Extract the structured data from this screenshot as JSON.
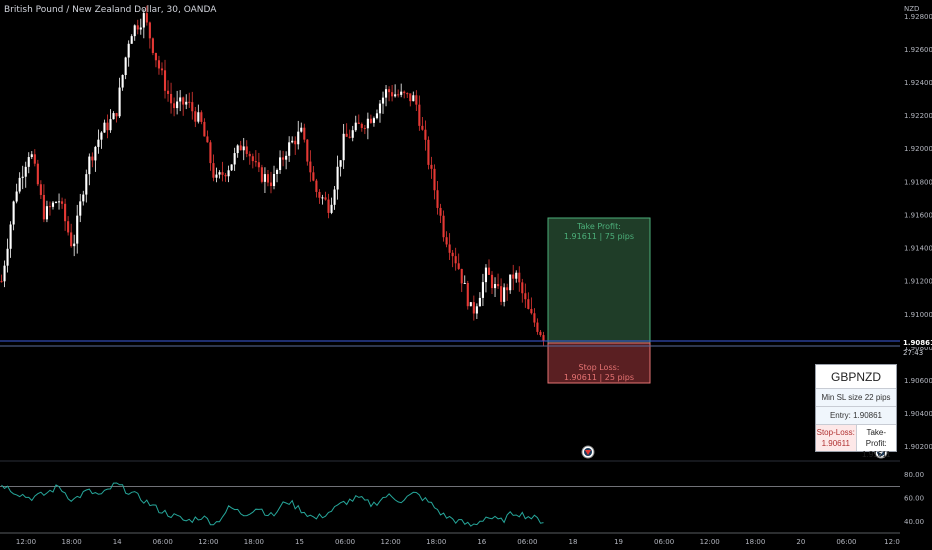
{
  "chart_title": "British Pound / New Zealand Dollar, 30, OANDA",
  "currency_label": "NZD",
  "colors": {
    "background": "#000000",
    "candle_up": "#ffffff",
    "candle_down": "#e53935",
    "tp_fill": "#1f3d28",
    "tp_border": "#4caf7a",
    "sl_fill": "#5a1f22",
    "sl_border": "#e57373",
    "indicator_line": "#26a69a",
    "price_line": "#3b5bdb",
    "price_badge": "#ffffff"
  },
  "long_position": {
    "take_profit_label": "Take Profit:",
    "take_profit_detail": "1.91611 | 75 pips",
    "stop_loss_label": "Stop Loss:",
    "stop_loss_detail": "1.90611 | 25 pips"
  },
  "price_marker": {
    "price": "1.90861",
    "countdown": "27:43"
  },
  "symbol_table": {
    "symbol": "GBPNZD",
    "min_sl": "Min SL size 22 pips",
    "entry": "Entry: 1.90861",
    "stop_loss_label": "Stop-Loss:",
    "stop_loss_value": "1.90611",
    "take_profit_label": "Take-Profit:",
    "take_profit_value": "1.91611"
  },
  "chart_data": [
    {
      "type": "candlestick",
      "title": "British Pound / New Zealand Dollar, 30, OANDA",
      "y_axis_ticks": [
        "1.92800",
        "1.92600",
        "1.92400",
        "1.92200",
        "1.92000",
        "1.91800",
        "1.91600",
        "1.91400",
        "1.91200",
        "1.91000",
        "1.90800",
        "1.90600",
        "1.90400",
        "1.90200"
      ],
      "ylim": [
        1.9015,
        1.9285
      ],
      "x_axis_ticks": [
        "12:00",
        "18:00",
        "14",
        "06:00",
        "12:00",
        "18:00",
        "15",
        "06:00",
        "12:00",
        "18:00",
        "16",
        "06:00",
        "18",
        "19",
        "06:00",
        "12:00",
        "18:00",
        "20",
        "06:00",
        "12:0"
      ],
      "series": [
        {
          "points": [
            {
              "t": 0,
              "p": 1.912
            },
            {
              "t": 1,
              "p": 1.9175
            },
            {
              "t": 2,
              "p": 1.92
            },
            {
              "t": 3,
              "p": 1.916
            },
            {
              "t": 4,
              "p": 1.917
            },
            {
              "t": 5,
              "p": 1.914
            },
            {
              "t": 6,
              "p": 1.919
            },
            {
              "t": 7,
              "p": 1.921
            },
            {
              "t": 8,
              "p": 1.922
            },
            {
              "t": 9,
              "p": 1.927
            },
            {
              "t": 10,
              "p": 1.928
            },
            {
              "t": 11,
              "p": 1.925
            },
            {
              "t": 12,
              "p": 1.9225
            },
            {
              "t": 13,
              "p": 1.9228
            },
            {
              "t": 14,
              "p": 1.9215
            },
            {
              "t": 15,
              "p": 1.918
            },
            {
              "t": 16,
              "p": 1.919
            },
            {
              "t": 17,
              "p": 1.9205
            },
            {
              "t": 18,
              "p": 1.9185
            },
            {
              "t": 19,
              "p": 1.918
            },
            {
              "t": 20,
              "p": 1.92
            },
            {
              "t": 21,
              "p": 1.921
            },
            {
              "t": 22,
              "p": 1.9175
            },
            {
              "t": 23,
              "p": 1.9165
            },
            {
              "t": 24,
              "p": 1.9205
            },
            {
              "t": 25,
              "p": 1.9213
            },
            {
              "t": 26,
              "p": 1.922
            },
            {
              "t": 27,
              "p": 1.9235
            },
            {
              "t": 28,
              "p": 1.9232
            },
            {
              "t": 29,
              "p": 1.923
            },
            {
              "t": 30,
              "p": 1.919
            },
            {
              "t": 31,
              "p": 1.915
            },
            {
              "t": 32,
              "p": 1.913
            },
            {
              "t": 33,
              "p": 1.91
            },
            {
              "t": 34,
              "p": 1.9125
            },
            {
              "t": 35,
              "p": 1.911
            },
            {
              "t": 36,
              "p": 1.9125
            },
            {
              "t": 37,
              "p": 1.91
            },
            {
              "t": 38,
              "p": 1.9087
            }
          ]
        }
      ],
      "current_price": 1.90861,
      "long_position_entry": 1.90861,
      "long_position_take_profit": 1.91611,
      "long_position_stop_loss": 1.90611
    },
    {
      "type": "line",
      "y_axis_ticks": [
        "80.00",
        "60.00",
        "40.00"
      ],
      "ylim": [
        30,
        90
      ],
      "levels": [
        70,
        30
      ],
      "series": [
        {
          "points": [
            {
              "t": 0,
              "v": 72
            },
            {
              "t": 1,
              "v": 65
            },
            {
              "t": 2,
              "v": 60
            },
            {
              "t": 3,
              "v": 63
            },
            {
              "t": 4,
              "v": 70
            },
            {
              "t": 5,
              "v": 58
            },
            {
              "t": 6,
              "v": 66
            },
            {
              "t": 7,
              "v": 62
            },
            {
              "t": 8,
              "v": 72
            },
            {
              "t": 9,
              "v": 65
            },
            {
              "t": 10,
              "v": 58
            },
            {
              "t": 11,
              "v": 50
            },
            {
              "t": 12,
              "v": 45
            },
            {
              "t": 13,
              "v": 40
            },
            {
              "t": 14,
              "v": 44
            },
            {
              "t": 15,
              "v": 38
            },
            {
              "t": 16,
              "v": 52
            },
            {
              "t": 17,
              "v": 46
            },
            {
              "t": 18,
              "v": 52
            },
            {
              "t": 19,
              "v": 44
            },
            {
              "t": 20,
              "v": 58
            },
            {
              "t": 21,
              "v": 50
            },
            {
              "t": 22,
              "v": 42
            },
            {
              "t": 23,
              "v": 48
            },
            {
              "t": 24,
              "v": 56
            },
            {
              "t": 25,
              "v": 60
            },
            {
              "t": 26,
              "v": 54
            },
            {
              "t": 27,
              "v": 62
            },
            {
              "t": 28,
              "v": 58
            },
            {
              "t": 29,
              "v": 64
            },
            {
              "t": 30,
              "v": 56
            },
            {
              "t": 31,
              "v": 45
            },
            {
              "t": 32,
              "v": 40
            },
            {
              "t": 33,
              "v": 36
            },
            {
              "t": 34,
              "v": 44
            },
            {
              "t": 35,
              "v": 40
            },
            {
              "t": 36,
              "v": 48
            },
            {
              "t": 37,
              "v": 44
            },
            {
              "t": 38,
              "v": 40
            }
          ]
        }
      ]
    }
  ]
}
